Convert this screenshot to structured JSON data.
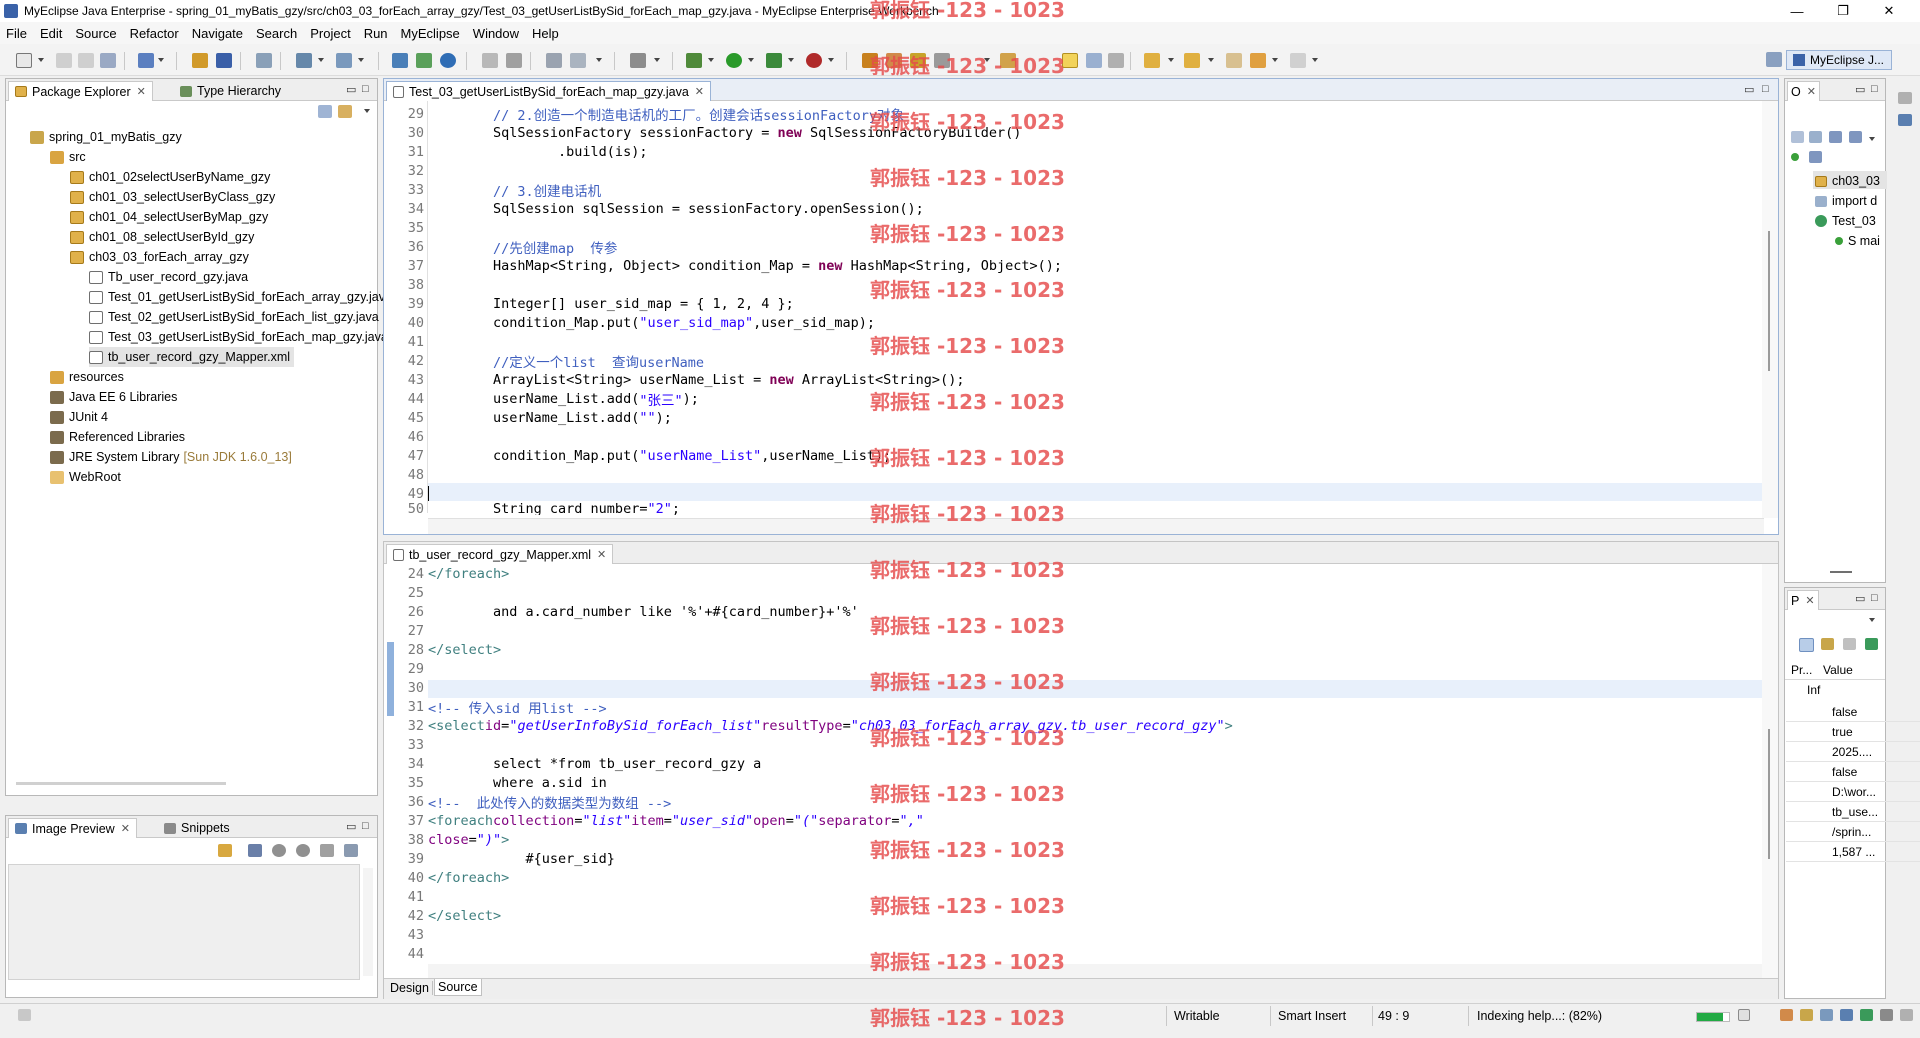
{
  "window": {
    "title": "MyEclipse Java Enterprise - spring_01_myBatis_gzy/src/ch03_03_forEach_array_gzy/Test_03_getUserListBySid_forEach_map_gzy.java - MyEclipse Enterprise Workbench",
    "controls": [
      "—",
      "❐",
      "✕"
    ]
  },
  "menu": [
    "File",
    "Edit",
    "Source",
    "Refactor",
    "Navigate",
    "Search",
    "Project",
    "Run",
    "MyEclipse",
    "Window",
    "Help"
  ],
  "perspective": {
    "label": "MyEclipse J..."
  },
  "package_explorer": {
    "tab_label": "Package Explorer",
    "second_tab_label": "Type Hierarchy",
    "project": "spring_01_myBatis_gzy",
    "src": "src",
    "packages": [
      "ch01_02selectUserByName_gzy",
      "ch01_03_selectUserByClass_gzy",
      "ch01_04_selectUserByMap_gzy",
      "ch01_08_selectUserById_gzy",
      "ch03_03_forEach_array_gzy"
    ],
    "files": [
      "Tb_user_record_gzy.java",
      "Test_01_getUserListBySid_forEach_array_gzy.java",
      "Test_02_getUserListBySid_forEach_list_gzy.java",
      "Test_03_getUserListBySid_forEach_map_gzy.java",
      "tb_user_record_gzy_Mapper.xml"
    ],
    "others": [
      {
        "label": "resources",
        "extra": ""
      },
      {
        "label": "Java EE 6 Libraries",
        "extra": ""
      },
      {
        "label": "JUnit 4",
        "extra": ""
      },
      {
        "label": "Referenced Libraries",
        "extra": ""
      },
      {
        "label": "JRE System Library",
        "extra": "[Sun JDK 1.6.0_13]"
      },
      {
        "label": "WebRoot",
        "extra": ""
      }
    ]
  },
  "image_preview": {
    "tab_label": "Image Preview",
    "second_tab_label": "Snippets"
  },
  "editor_top": {
    "tab_label": "Test_03_getUserListBySid_forEach_map_gzy.java",
    "line_numbers": [
      "29",
      "30",
      "31",
      "32",
      "33",
      "34",
      "35",
      "36",
      "37",
      "38",
      "39",
      "40",
      "41",
      "42",
      "43",
      "44",
      "45",
      "46",
      "47",
      "48",
      "49",
      "50"
    ]
  },
  "editor_bottom": {
    "tab_label": "tb_user_record_gzy_Mapper.xml",
    "line_numbers": [
      "24",
      "25",
      "26",
      "27",
      "28",
      "29",
      "30",
      "31",
      "32",
      "33",
      "34",
      "35",
      "36",
      "37",
      "38",
      "39",
      "40",
      "41",
      "42",
      "43",
      "44"
    ],
    "bottom_tabs": [
      "Design",
      "Source"
    ]
  },
  "outline": {
    "tab_label": "O",
    "items": [
      "ch03_03",
      "import d",
      "Test_03",
      "S mai"
    ]
  },
  "properties": {
    "tab_label": "P",
    "col_property": "Pr...",
    "col_value": "Value",
    "section": "Inf",
    "values": [
      "false",
      "true",
      "2025....",
      "false",
      "D:\\wor...",
      "tb_use...",
      "/sprin...",
      "1,587 ..."
    ]
  },
  "statusbar": {
    "writable": "Writable",
    "insert_mode": "Smart Insert",
    "position": "49 : 9",
    "progress": "Indexing help...: (82%)",
    "progress_value": 0.82
  },
  "watermark": "郭振钰 -123 - 1023",
  "colors": {
    "accent": "#3a62a8",
    "watermark": "#e64b4b",
    "keyword": "#7f0055",
    "string": "#2a00ff",
    "comment": "#3f5fbf"
  }
}
